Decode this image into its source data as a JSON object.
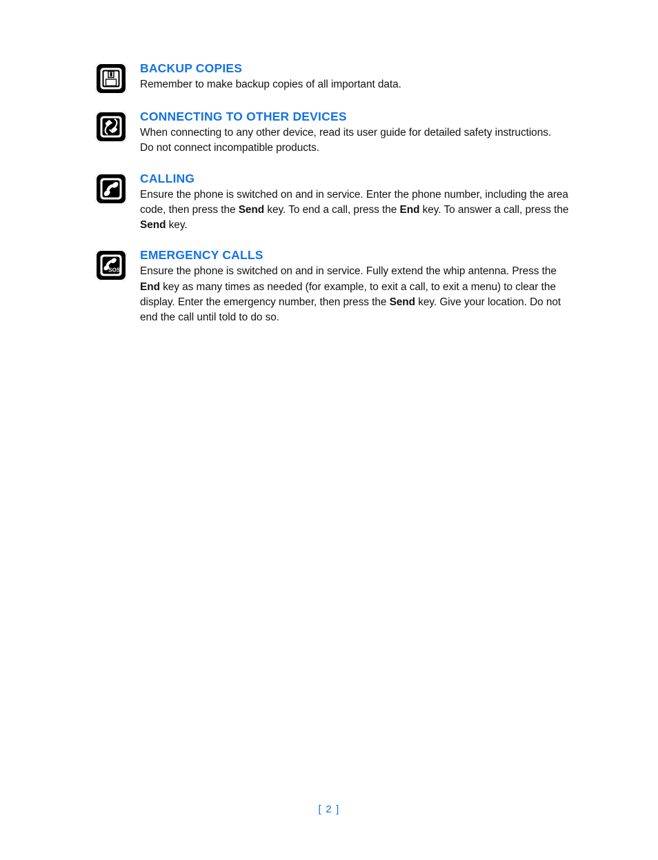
{
  "page": {
    "background_color": "#ffffff",
    "heading_color": "#1373E6",
    "body_color": "#111111",
    "icon_color": "#000000",
    "footer_text": "[ 2 ]"
  },
  "sections": [
    {
      "icon_name": "floppy-disk-icon",
      "heading": "BACKUP COPIES",
      "body_runs": [
        {
          "text": "Remember to make backup copies of all important data.",
          "bold": false
        }
      ]
    },
    {
      "icon_name": "connector-plug-icon",
      "heading": "CONNECTING TO OTHER DEVICES",
      "body_runs": [
        {
          "text": "When connecting to any other device, read its user guide for detailed safety instructions. Do not connect incompatible products.",
          "bold": false
        }
      ]
    },
    {
      "icon_name": "telephone-handset-icon",
      "heading": "CALLING",
      "body_runs": [
        {
          "text": "Ensure the phone is switched on and in service. Enter the phone number, including the area code, then press the ",
          "bold": false
        },
        {
          "text": "Send",
          "bold": true
        },
        {
          "text": " key. To end a call, press the ",
          "bold": false
        },
        {
          "text": "End",
          "bold": true
        },
        {
          "text": " key. To answer a call, press the ",
          "bold": false
        },
        {
          "text": "Send",
          "bold": true
        },
        {
          "text": " key.",
          "bold": false
        }
      ]
    },
    {
      "icon_name": "emergency-sos-handset-icon",
      "heading": "EMERGENCY CALLS",
      "body_runs": [
        {
          "text": "Ensure the phone is switched on and in service. Fully extend the whip antenna. Press the ",
          "bold": false
        },
        {
          "text": "End",
          "bold": true
        },
        {
          "text": " key as many times as needed (for example, to exit a call, to exit a menu) to clear the display. Enter the emergency number, then press the ",
          "bold": false
        },
        {
          "text": "Send",
          "bold": true
        },
        {
          "text": " key. Give your location. Do not end the call until told to do so.",
          "bold": false
        }
      ]
    }
  ]
}
